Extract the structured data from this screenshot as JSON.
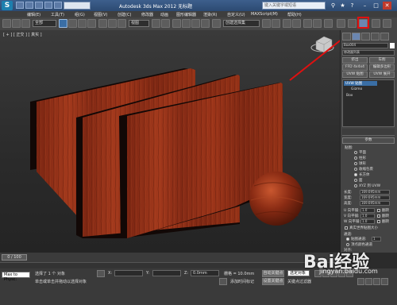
{
  "app": {
    "title": "Autodesk 3ds Max  2012    无标题",
    "logo": "S",
    "search_placeholder": "键入关键字或短语"
  },
  "menu": [
    "编辑(E)",
    "工具(T)",
    "组(G)",
    "视图(V)",
    "创建(C)",
    "修改器",
    "动画",
    "图形编辑器",
    "渲染(R)",
    "自定义(U)",
    "MAXScript(M)",
    "帮助(H)"
  ],
  "toolbar": {
    "selection_filter": "全部",
    "view_mode": "视图",
    "named_set": "创建选择集"
  },
  "viewport": {
    "label": "[ + ] [ 正交 ] [ 真实 ]"
  },
  "command_panel": {
    "object_name": "Box004",
    "modifier_list": "修改器列表",
    "buttons": [
      "挤出",
      "车削",
      "FFD 4x4x4",
      "编辑多边形",
      "UVW 贴图",
      "UVW 展开"
    ],
    "stack": [
      "UVW 贴图",
      "Gizmo",
      "Box"
    ],
    "rollout_title": "参数",
    "mapping_label": "贴图:",
    "mapping_options": [
      "平面",
      "柱形",
      "球形",
      "收缩包裹",
      "长方体",
      "面",
      "XYZ 到 UVW"
    ],
    "length_label": "长度:",
    "length_value": "169.695mm",
    "width_label": "宽度:",
    "width_value": "169.695mm",
    "height_label": "高度:",
    "height_value": "169.695mm",
    "u_tile_label": "U 向平铺:",
    "u_tile_value": "1.0",
    "v_tile_label": "V 向平铺:",
    "v_tile_value": "1.0",
    "w_tile_label": "W 向平铺:",
    "w_tile_value": "1.0",
    "flip_label": "翻转",
    "real_world_label": "真实世界贴图大小",
    "channel_label": "通道:",
    "map_channel_label": "贴图通道:",
    "map_channel_value": "1",
    "vertex_color_label": "顶点颜色通道",
    "align_label": "对齐:"
  },
  "timeline": {
    "frame": "0 / 100"
  },
  "status": {
    "listener": "Max to Physc:",
    "selected": "选择了 1 个 对象",
    "prompt": "单击或单击并拖动以选择对象",
    "x_label": "X:",
    "y_label": "Y:",
    "z_label": "Z:",
    "z_value": "0.0mm",
    "grid": "栅格 = 10.0mm",
    "auto_key": "自动关键点",
    "selected_obj": "选定对象",
    "set_key": "设置关键点",
    "key_filter": "关键点过滤器",
    "add_tag": "添加时间标记"
  },
  "watermark": {
    "brand": "Bai经验",
    "url": "jingyan.baidu.com"
  },
  "colors": {
    "wood": "#8a2a14",
    "highlight_box": "#e01010"
  }
}
